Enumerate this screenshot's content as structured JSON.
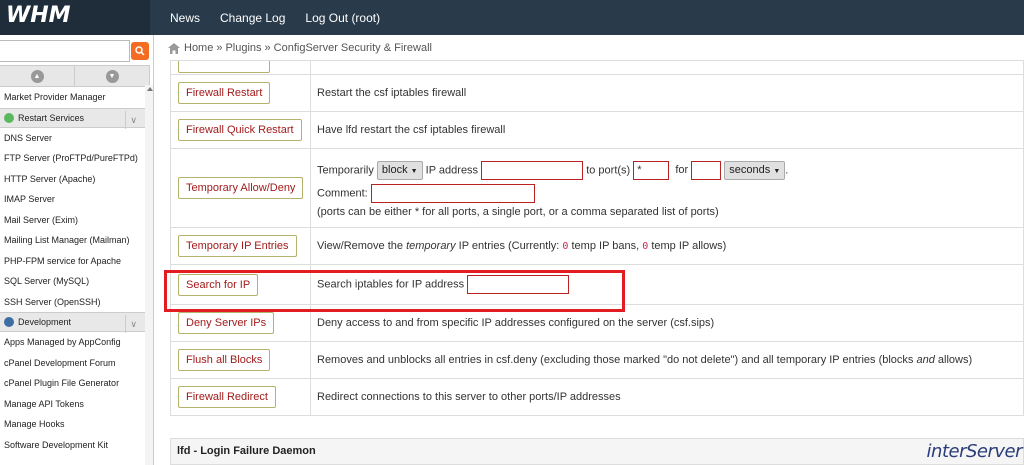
{
  "header": {
    "logo_text": "WHM",
    "nav": [
      "News",
      "Change Log",
      "Log Out (root)"
    ]
  },
  "sidebar": {
    "search_placeholder": "",
    "items": [
      {
        "type": "item",
        "label": "Market Provider Manager"
      },
      {
        "type": "category",
        "label": "Restart Services",
        "icon_color": "#5cb85c"
      },
      {
        "type": "item",
        "label": "DNS Server"
      },
      {
        "type": "item",
        "label": "FTP Server (ProFTPd/PureFTPd)"
      },
      {
        "type": "item",
        "label": "HTTP Server (Apache)"
      },
      {
        "type": "item",
        "label": "IMAP Server"
      },
      {
        "type": "item",
        "label": "Mail Server (Exim)"
      },
      {
        "type": "item",
        "label": "Mailing List Manager (Mailman)"
      },
      {
        "type": "item",
        "label": "PHP-FPM service for Apache"
      },
      {
        "type": "item",
        "label": "SQL Server (MySQL)"
      },
      {
        "type": "item",
        "label": "SSH Server (OpenSSH)"
      },
      {
        "type": "category",
        "label": "Development",
        "icon_color": "#3a6ea5"
      },
      {
        "type": "item",
        "label": "Apps Managed by AppConfig"
      },
      {
        "type": "item",
        "label": "cPanel Development Forum"
      },
      {
        "type": "item",
        "label": "cPanel Plugin File Generator"
      },
      {
        "type": "item",
        "label": "Manage API Tokens"
      },
      {
        "type": "item",
        "label": "Manage Hooks"
      },
      {
        "type": "item",
        "label": "Software Development Kit"
      }
    ]
  },
  "breadcrumb": {
    "home": "Home",
    "sep": "»",
    "plugins": "Plugins",
    "current": "ConfigServer Security & Firewall"
  },
  "rows": {
    "firewall_restart": {
      "label": "Firewall Restart",
      "desc": "Restart the csf iptables firewall"
    },
    "firewall_quick_restart": {
      "label": "Firewall Quick Restart",
      "desc": "Have lfd restart the csf iptables firewall"
    },
    "temporary_allow_deny": {
      "label": "Temporary Allow/Deny",
      "t1": "Temporarily",
      "action_value": "block",
      "t2": "IP address",
      "t3": "to port(s)",
      "ports_value": "*",
      "t4": "for",
      "unit_value": "seconds",
      "t5": ".",
      "comment_label": "Comment:",
      "note": "(ports can be either * for all ports, a single port, or a comma separated list of ports)"
    },
    "temporary_ip_entries": {
      "label": "Temporary IP Entries",
      "d1": "View/Remove the",
      "d_em": "temporary",
      "d2": "IP entries (Currently:",
      "bans": "0",
      "d3": "temp IP bans,",
      "allows": "0",
      "d4": "temp IP allows)"
    },
    "search_for_ip": {
      "label": "Search for IP",
      "desc": "Search iptables for IP address"
    },
    "deny_server_ips": {
      "label": "Deny Server IPs",
      "desc": "Deny access to and from specific IP addresses configured on the server (csf.sips)"
    },
    "flush_all_blocks": {
      "label": "Flush all Blocks",
      "d1": "Removes and unblocks all entries in csf.deny (excluding those marked \"do not delete\") and all temporary IP entries (blocks",
      "d_em": "and",
      "d2": "allows)"
    },
    "firewall_redirect": {
      "label": "Firewall Redirect",
      "desc": "Redirect connections to this server to other ports/IP addresses"
    }
  },
  "lfd_section": {
    "title": "lfd - Login Failure Daemon"
  },
  "brand": {
    "interserver": "interServer",
    "highlight_color": "#e31b23"
  }
}
